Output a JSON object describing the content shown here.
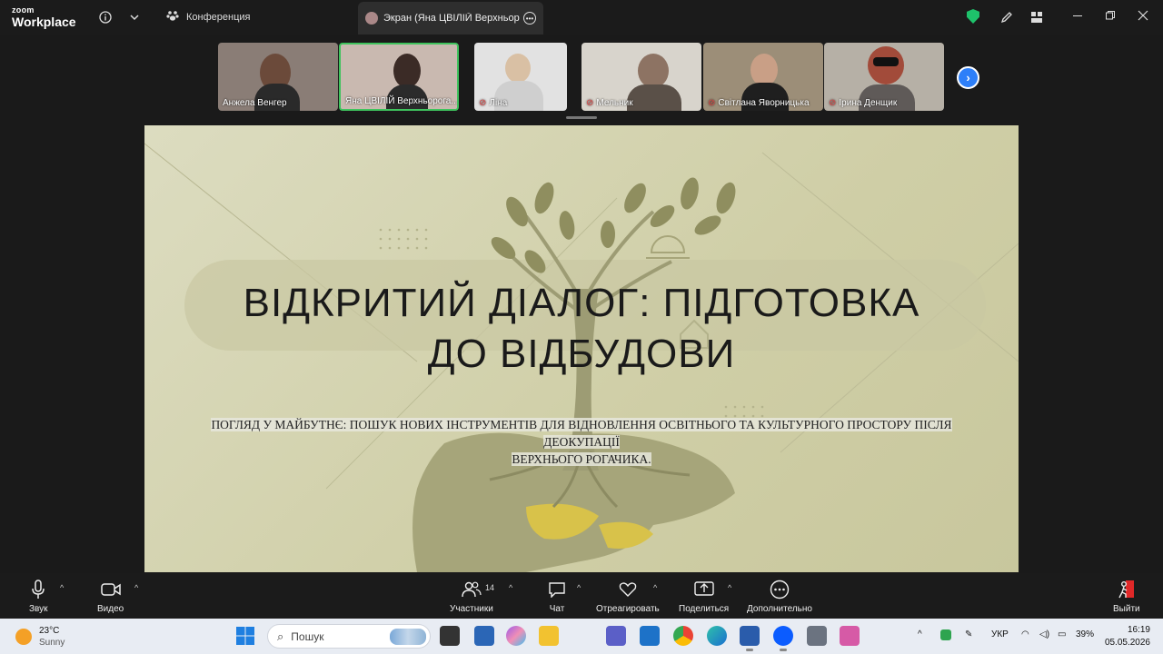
{
  "app": {
    "logo_top": "zoom",
    "logo_bottom": "Workplace",
    "meeting_label": "Конференция",
    "screen_tab_label": "Экран (Яна ЦВІЛІЙ Верхньорога",
    "icons": [
      "info-icon",
      "chevron-down-icon",
      "paw-icon",
      "shield-icon",
      "pencil-icon",
      "grid-icon",
      "minimize-icon",
      "restore-icon",
      "close-icon"
    ]
  },
  "participants": [
    {
      "name": "Анжела Венгер",
      "muted": false,
      "active": false,
      "bg": "#8a7d76"
    },
    {
      "name": "Яна ЦВІЛІЙ Верхньорога...",
      "muted": false,
      "active": true,
      "bg": "#c9b9b0"
    },
    {
      "name": "Ліна",
      "muted": true,
      "active": false,
      "bg": "#e2e2e2"
    },
    {
      "name": "Мельник",
      "muted": true,
      "active": false,
      "bg": "#d8d4cc"
    },
    {
      "name": "Світлана Яворницька",
      "muted": true,
      "active": false,
      "bg": "#9c8e78"
    },
    {
      "name": "Ірина Денщик",
      "muted": true,
      "active": false,
      "bg": "#b6b0a6"
    }
  ],
  "slide": {
    "title_line1": "ВІДКРИТИЙ ДІАЛОГ: ПІДГОТОВКА",
    "title_line2": "ДО ВІДБУДОВИ",
    "subtitle_line1": "ПОГЛЯД У МАЙБУТНЄ: ПОШУК НОВИХ ІНСТРУМЕНТІВ ДЛЯ ВІДНОВЛЕННЯ ОСВІТНЬОГО ТА КУЛЬТУРНОГО ПРОСТОРУ ПІСЛЯ ДЕОКУПАЦІЇ",
    "subtitle_line2": "ВЕРХНЬОГО РОГАЧИКА."
  },
  "toolbar": {
    "audio": "Звук",
    "video": "Видео",
    "participants": "Участники",
    "participants_count": "14",
    "chat": "Чат",
    "react": "Отреагировать",
    "share": "Поделиться",
    "more": "Дополнительно",
    "leave": "Выйти"
  },
  "taskbar": {
    "temp": "23°C",
    "weather": "Sunny",
    "search_placeholder": "Пошук",
    "lang": "УКР",
    "battery": "39%",
    "time": "16:19",
    "date": "05.05.2026"
  },
  "colors": {
    "active_border": "#3fc35d",
    "muted": "#e04444",
    "accent_blue": "#2d7ff9",
    "leave": "#e02828"
  }
}
